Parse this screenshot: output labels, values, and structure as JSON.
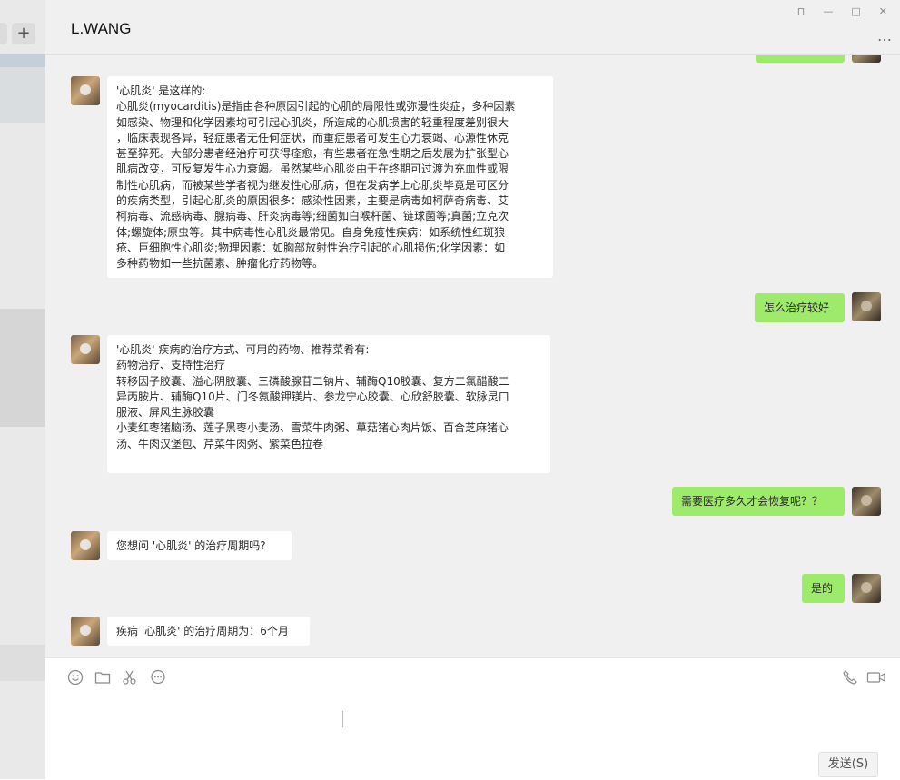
{
  "sidebar": {
    "add_label": "+"
  },
  "chat": {
    "title": "L.WANG",
    "window_controls": [
      "⊓",
      "—",
      "□",
      "✕"
    ],
    "more": "…"
  },
  "messages": [
    {
      "from": "other",
      "lines": [
        "'心肌炎' 是这样的:",
        "心肌炎(myocarditis)是指由各种原因引起的心肌的局限性或弥漫性炎症，多种因素",
        "如感染、物理和化学因素均可引起心肌炎，所造成的心肌损害的轻重程度差别很大",
        "，临床表现各异，轻症患者无任何症状，而重症患者可发生心力衰竭、心源性休克",
        "甚至猝死。大部分患者经治疗可获得痊愈，有些患者在急性期之后发展为扩张型心",
        "肌病改变，可反复发生心力衰竭。虽然某些心肌炎由于在终期可过渡为充血性或限",
        "制性心肌病，而被某些学者视为继发性心肌病，但在发病学上心肌炎毕竟是可区分",
        "的疾病类型，引起心肌炎的原因很多：感染性因素，主要是病毒如柯萨奇病毒、艾",
        "柯病毒、流感病毒、腺病毒、肝炎病毒等;细菌如白喉杆菌、链球菌等;真菌;立克次",
        "体;螺旋体;原虫等。其中病毒性心肌炎最常见。自身免疫性疾病：如系统性红斑狼",
        "疮、巨细胞性心肌炎;物理因素：如胸部放射性治疗引起的心肌损伤;化学因素：如",
        "多种药物如一些抗菌素、肿瘤化疗药物等。"
      ]
    },
    {
      "from": "self",
      "lines": [
        "怎么治疗较好"
      ]
    },
    {
      "from": "other",
      "lines": [
        "'心肌炎' 疾病的治疗方式、可用的药物、推荐菜肴有:",
        "药物治疗、支持性治疗",
        "转移因子胶囊、溢心阴胶囊、三磷酸腺苷二钠片、辅酶Q10胶囊、复方二氯醋酸二",
        "异丙胺片、辅酶Q10片、门冬氨酸钾镁片、参龙宁心胶囊、心欣舒胶囊、软脉灵口",
        "服液、屏风生脉胶囊",
        "小麦红枣猪脑汤、莲子黑枣小麦汤、雪菜牛肉粥、草菇猪心肉片饭、百合芝麻猪心",
        "汤、牛肉汉堡包、芹菜牛肉粥、紫菜色拉卷"
      ]
    },
    {
      "from": "self",
      "lines": [
        "需要医疗多久才会恢复呢？？"
      ]
    },
    {
      "from": "other",
      "lines": [
        "您想问 '心肌炎' 的治疗周期吗?"
      ]
    },
    {
      "from": "self",
      "lines": [
        "是的"
      ]
    },
    {
      "from": "other",
      "lines": [
        "疾病 '心肌炎' 的治疗周期为：6个月"
      ]
    }
  ],
  "composer": {
    "tools": [
      "emoji-icon",
      "folder-icon",
      "scissors-icon",
      "chat-bubble-icon"
    ],
    "send_label": "发送(S)"
  },
  "colors": {
    "self_bubble": "#9eea6a",
    "other_bubble": "#ffffff",
    "chat_bg": "#f0f0f0"
  }
}
